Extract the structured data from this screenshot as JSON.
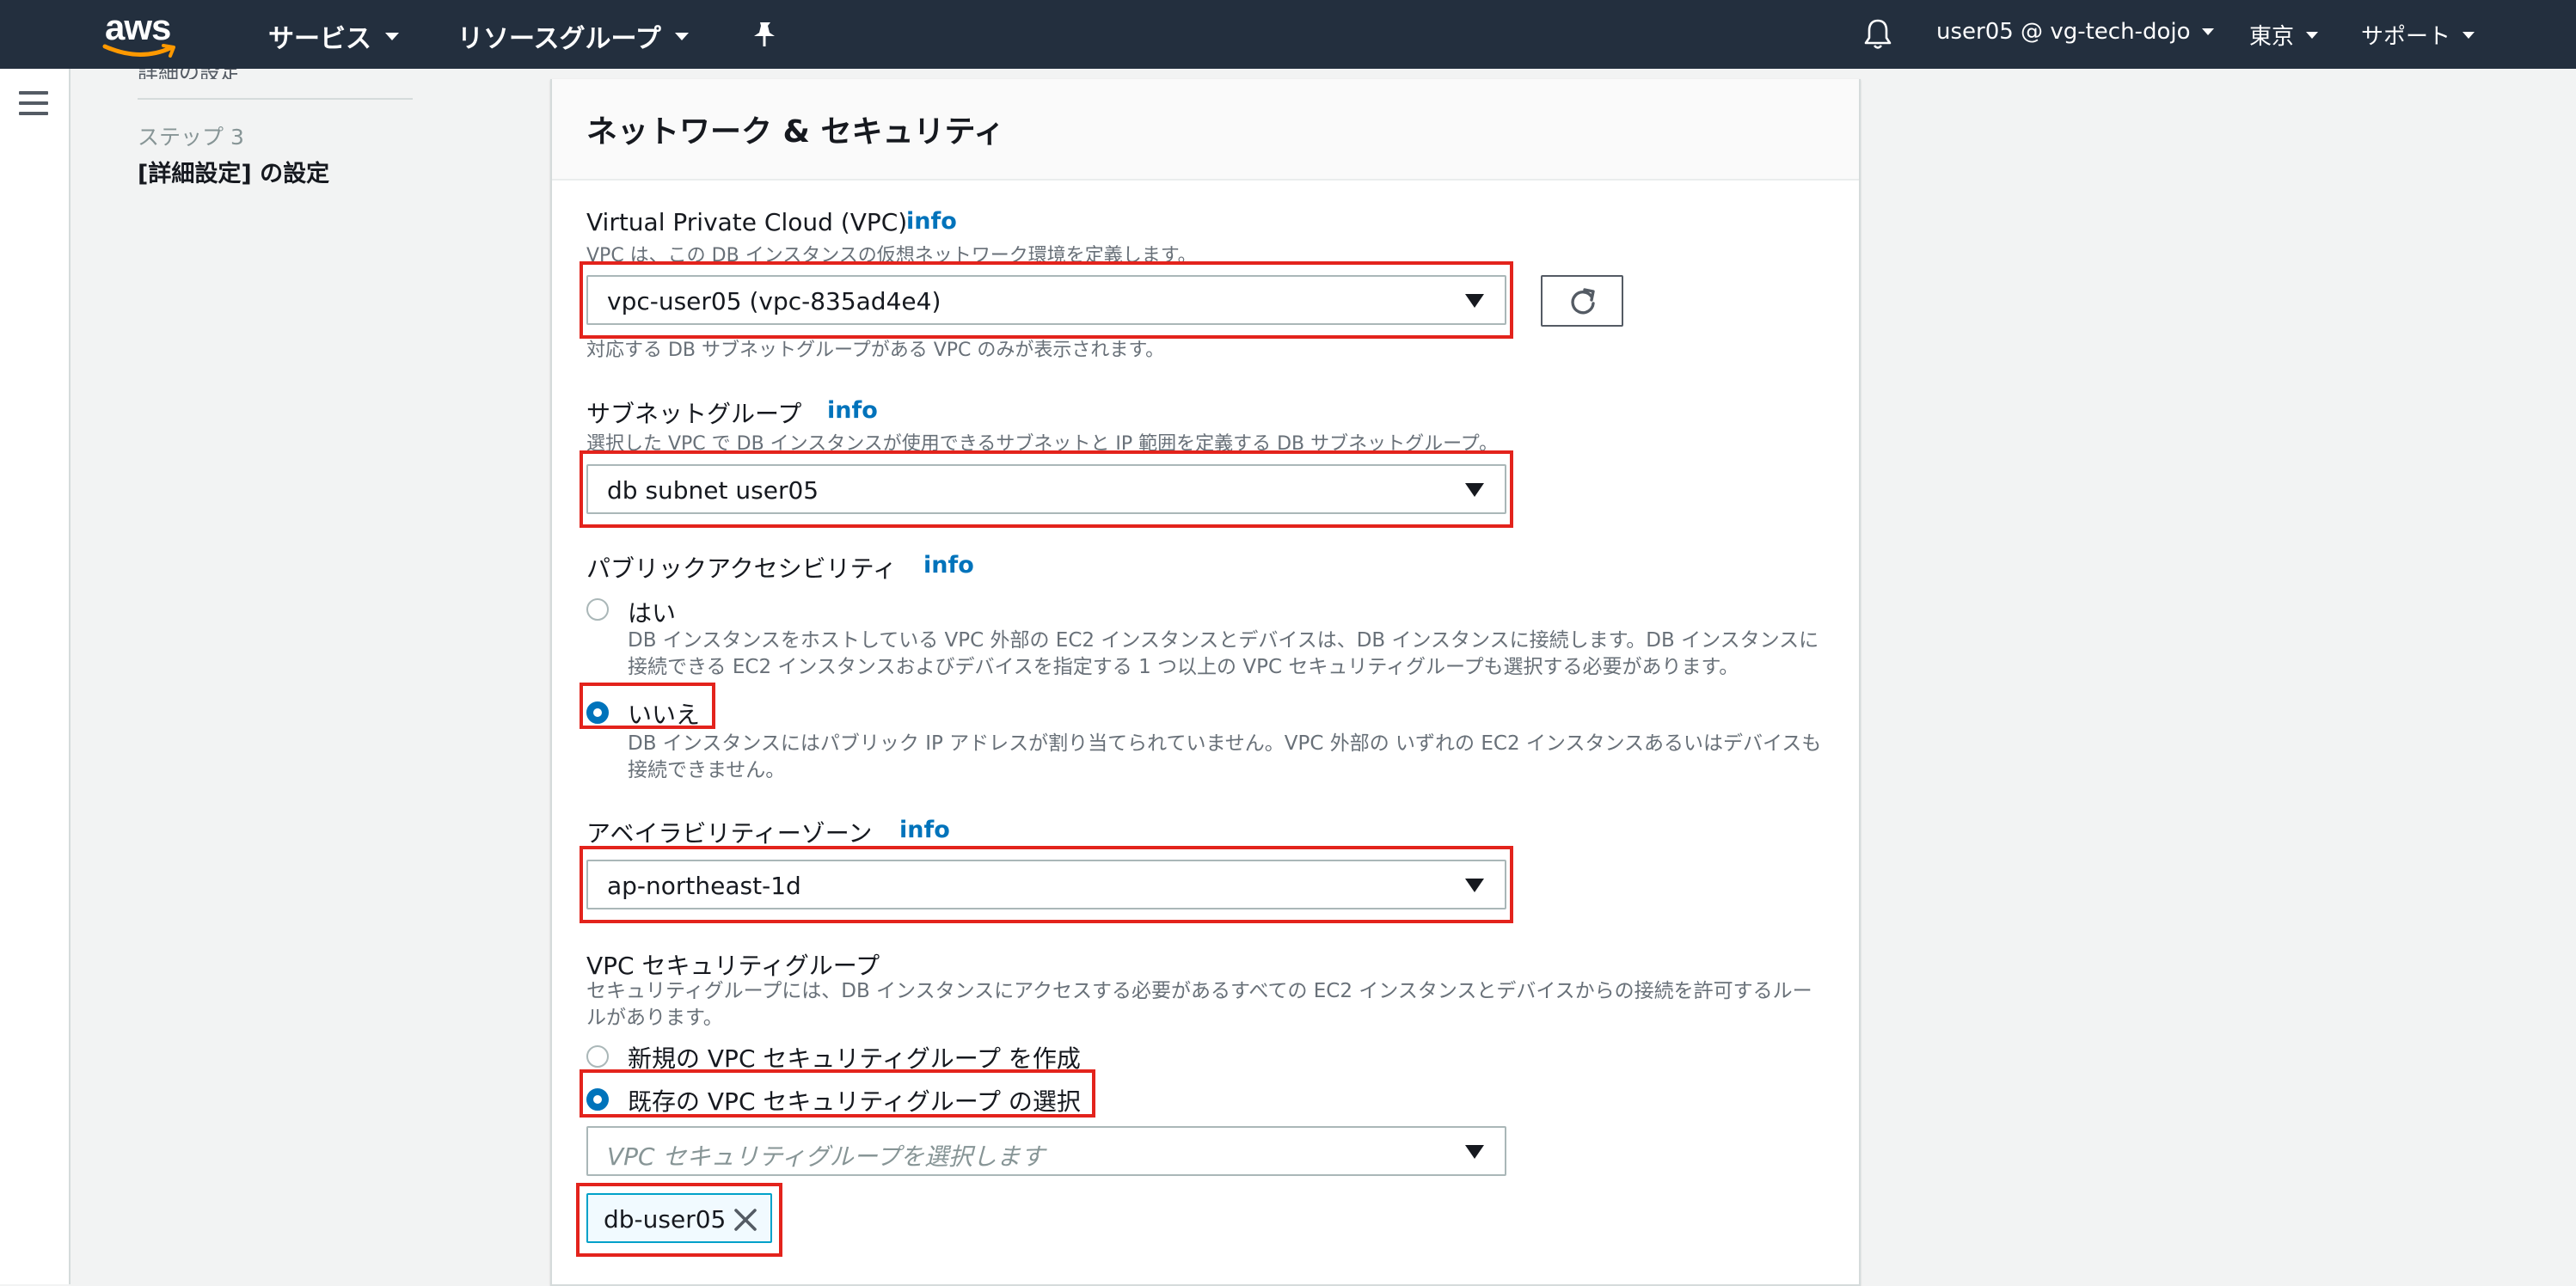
{
  "topnav": {
    "logo": "aws",
    "services": "サービス",
    "resource_groups": "リソースグループ",
    "pin_icon": "pin-icon",
    "bell_icon": "bell-icon",
    "account": "user05 @ vg-tech-dojo",
    "region": "東京",
    "support": "サポート"
  },
  "steps": {
    "prev_step_partial": "詳細の設定",
    "current_step_label": "ステップ 3",
    "current_step_title": "[詳細設定] の設定"
  },
  "panel": {
    "title": "ネットワーク & セキュリティ",
    "vpc": {
      "label": "Virtual Private Cloud (VPC)",
      "info": "info",
      "hint": "VPC は、この DB インスタンスの仮想ネットワーク環境を定義します。",
      "value": "vpc-user05 (vpc-835ad4e4)",
      "footnote": "対応する DB サブネットグループがある VPC のみが表示されます。"
    },
    "subnet": {
      "label": "サブネットグループ",
      "info": "info",
      "hint": "選択した VPC で DB インスタンスが使用できるサブネットと IP 範囲を定義する DB サブネットグループ。",
      "value": "db subnet user05"
    },
    "public": {
      "label": "パブリックアクセシビリティ",
      "info": "info",
      "yes_label": "はい",
      "yes_desc": "DB インスタンスをホストしている VPC 外部の EC2 インスタンスとデバイスは、DB インスタンスに接続します。DB インスタンスに接続できる EC2 インスタンスおよびデバイスを指定する 1 つ以上の VPC セキュリティグループも選択する必要があります。",
      "no_label": "いいえ",
      "no_desc": "DB インスタンスにはパブリック IP アドレスが割り当てられていません。VPC 外部の いずれの EC2 インスタンスあるいはデバイスも接続できません。",
      "selected": "いいえ"
    },
    "az": {
      "label": "アベイラビリティーゾーン",
      "info": "info",
      "value": "ap-northeast-1d"
    },
    "sg": {
      "label": "VPC セキュリティグループ",
      "desc": "セキュリティグループには、DB インスタンスにアクセスする必要があるすべての EC2 インスタンスとデバイスからの接続を許可するルールがあります。",
      "create_label": "新規の VPC セキュリティグループ を作成",
      "existing_label": "既存の VPC セキュリティグループ の選択",
      "selected": "既存の VPC セキュリティグループ の選択",
      "placeholder": "VPC セキュリティグループを選択します",
      "token": "db-user05"
    }
  },
  "colors": {
    "nav_bg": "#232f3e",
    "link": "#0073bb",
    "highlight": "#e3231c",
    "token_border": "#00a1c9"
  }
}
